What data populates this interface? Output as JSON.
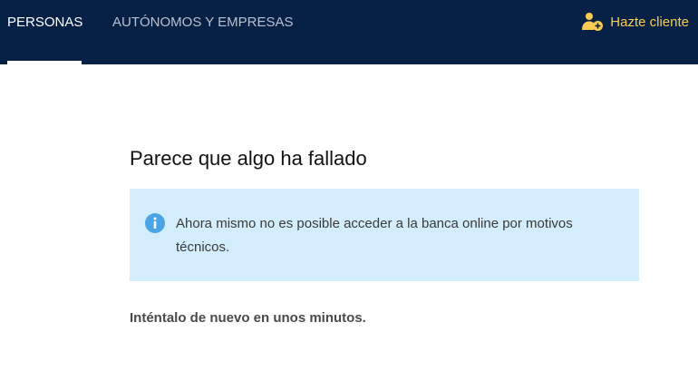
{
  "nav": {
    "tabs": [
      {
        "label": "PERSONAS",
        "active": true
      },
      {
        "label": "AUTÓNOMOS Y EMPRESAS",
        "active": false
      }
    ],
    "signup_label": "Hazte cliente",
    "signup_icon": "user-add-icon"
  },
  "error": {
    "title": "Parece que algo ha fallado",
    "info_icon": "info-icon",
    "message": "Ahora mismo no es posible acceder a la banca online por motivos técnicos.",
    "retry": "Inténtalo de nuevo en unos minutos."
  },
  "colors": {
    "header_bg": "#072146",
    "signup_accent": "#F8CD51",
    "info_bg": "#D4EDFC",
    "info_icon": "#49A5E6"
  }
}
